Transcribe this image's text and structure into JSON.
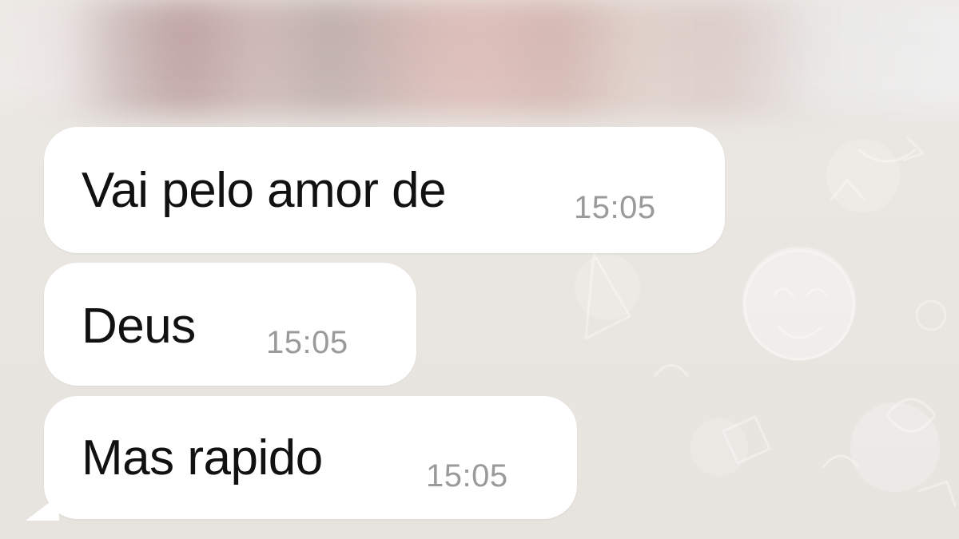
{
  "messages": [
    {
      "text": "Vai pelo amor de",
      "time": "15:05"
    },
    {
      "text": "Deus",
      "time": "15:05"
    },
    {
      "text": "Mas rapido",
      "time": "15:05"
    }
  ],
  "colors": {
    "chat_background": "#e9e6e1",
    "bubble_background": "#ffffff",
    "message_text": "#111111",
    "timestamp_text": "#9a9a9a"
  },
  "icons": {
    "background_pattern": "chat-doodle-pattern-icon"
  }
}
